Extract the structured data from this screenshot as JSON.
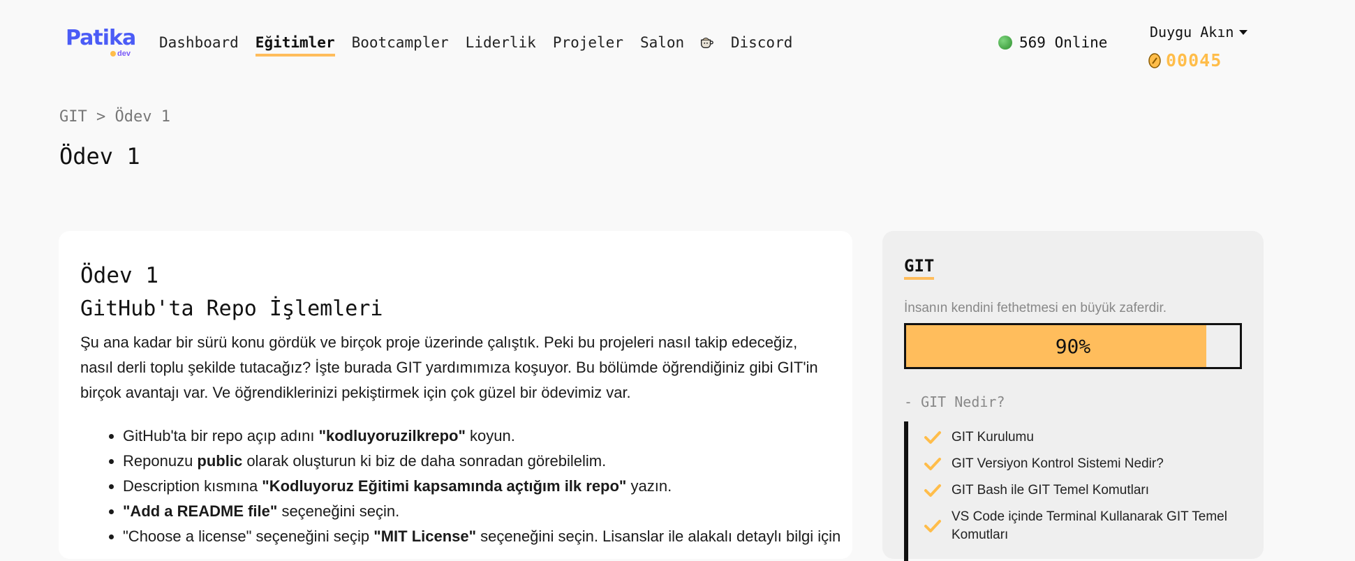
{
  "nav": {
    "logo_text": "Patika",
    "logo_sub": "dev",
    "links": [
      "Dashboard",
      "Eğitimler",
      "Bootcampler",
      "Liderlik",
      "Projeler",
      "Salon",
      "Discord"
    ],
    "active_link": "Eğitimler",
    "online_text": "569 Online",
    "user_name": "Duygu Akın",
    "coins": "00045",
    "colors": {
      "accent": "#ffbd5c",
      "coin": "#ffbd4a",
      "logo": "#4b5cf6"
    }
  },
  "header": {
    "breadcrumb": "GIT > Ödev 1",
    "title": "Ödev 1"
  },
  "content": {
    "heading": "Ödev 1",
    "subheading": "GitHub'ta Repo İşlemleri",
    "intro": "Şu ana kadar bir sürü konu gördük ve birçok proje üzerinde çalıştık. Peki bu projeleri nasıl takip edeceğiz, nasıl derli toplu şekilde tutacağız? İşte burada GIT yardımımıza koşuyor. Bu bölümde öğrendiğiniz gibi GIT'in birçok avantajı var. Ve öğrendiklerinizi pekiştirmek için çok güzel bir ödevimiz var.",
    "steps": [
      {
        "pre": "GitHub'ta bir repo açıp adını ",
        "bold": "\"kodluyoruzilkrepo\"",
        "post": " koyun."
      },
      {
        "pre": "Reponuzu ",
        "bold": "public",
        "post": " olarak oluşturun ki biz de daha sonradan görebilelim."
      },
      {
        "pre": "Description kısmına ",
        "bold": "\"Kodluyoruz Eğitimi kapsamında açtığım ilk repo\"",
        "post": " yazın."
      },
      {
        "pre": "",
        "bold": "\"Add a README file\"",
        "post": " seçeneğini seçin."
      },
      {
        "pre": "\"Choose a license\" seçeneğini seçip ",
        "bold": "\"MIT License\"",
        "post": " seçeneğini seçin. Lisanslar ile alakalı detaylı bilgi için"
      }
    ]
  },
  "sidebar": {
    "title": "GIT",
    "quote": "İnsanın kendini fethetmesi en büyük zaferdir.",
    "progress_percent": 90,
    "progress_label": "90%",
    "section_label": "- GIT Nedir?",
    "lessons": [
      "GIT Kurulumu",
      "GIT Versiyon Kontrol Sistemi Nedir?",
      "GIT Bash ile GIT Temel Komutları",
      "VS Code içinde Terminal Kullanarak GIT Temel Komutları"
    ],
    "check_icon": "check-icon"
  }
}
